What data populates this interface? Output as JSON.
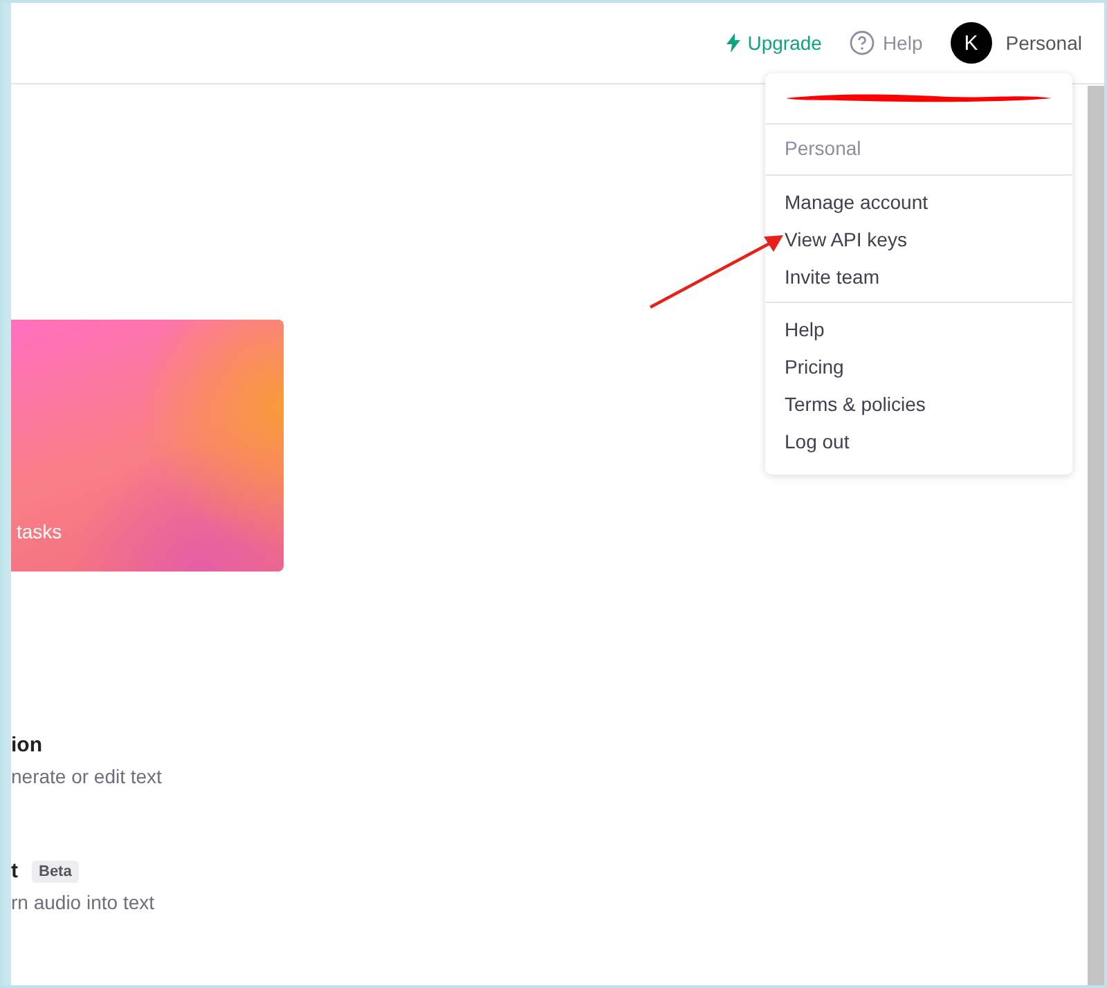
{
  "header": {
    "upgrade": "Upgrade",
    "help": "Help",
    "avatar_initial": "K",
    "account": "Personal"
  },
  "menu": {
    "workspace": "Personal",
    "groups": [
      [
        "Manage account",
        "View API keys",
        "Invite team"
      ],
      [
        "Help",
        "Pricing",
        "Terms & policies",
        "Log out"
      ]
    ]
  },
  "card": {
    "caption": "tasks"
  },
  "rows": [
    {
      "title": "ion",
      "description": "nerate or edit text"
    },
    {
      "title": "t",
      "badge": "Beta",
      "description": "rn audio into text"
    }
  ]
}
